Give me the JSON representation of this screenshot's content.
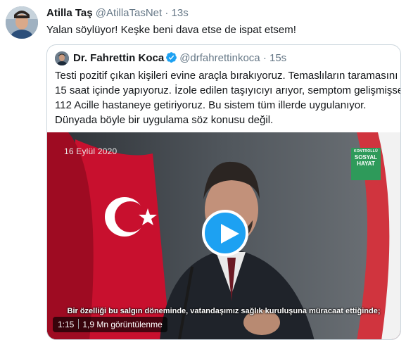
{
  "tweet": {
    "author_name": "Atilla Taş",
    "author_handle": "@AtillaTasNet",
    "separator": "·",
    "timestamp": "13s",
    "text": "Yalan söylüyor! Keşke beni dava etse de ispat etsem!"
  },
  "quoted": {
    "author_name": "Dr. Fahrettin Koca",
    "author_handle": "@drfahrettinkoca",
    "separator": "·",
    "timestamp": "15s",
    "text_lines": [
      "Testi pozitif çıkan kişileri evine araçla bırakıyoruz. Temaslıların taramasını",
      "15 saat içinde yapıyoruz. İzole edilen taşıyıcıyı arıyor, semptom gelişmişse",
      "112 Acille hastaneye getiriyoruz. Bu sistem tüm illerde uygulanıyor.",
      "Dünyada böyle bir uygulama söz konusu değil."
    ],
    "verified_color": "#1da1f2"
  },
  "video": {
    "date_overlay": "16 Eylül 2020",
    "badge": {
      "line1": "KONTROLLÜ",
      "line2": "SOSYAL",
      "line3": "HAYAT"
    },
    "subtitle": "Bir özelliği bu salgın döneminde, vatandaşımız sağlık kuruluşuna müracaat ettiğinde;",
    "duration": "1:15",
    "views": "1,9 Mn görüntülenme",
    "play_color": "#1da1f2"
  }
}
